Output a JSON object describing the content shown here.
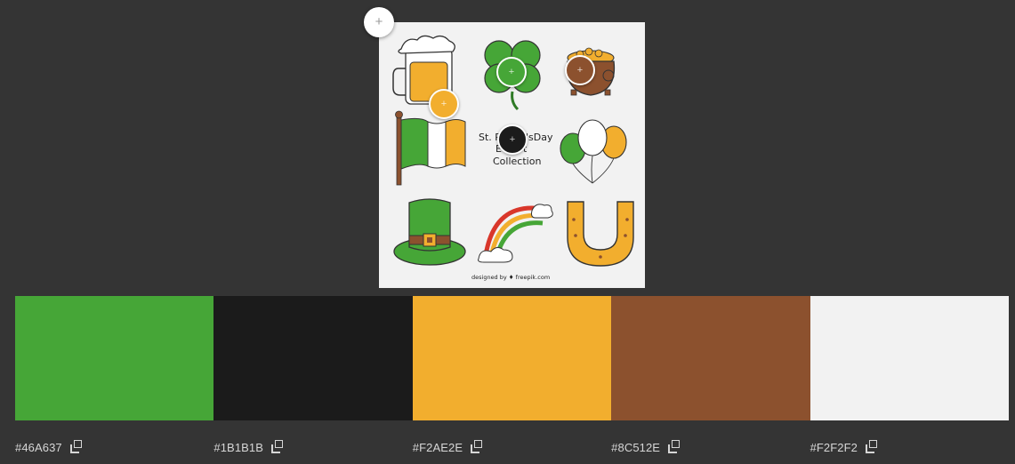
{
  "image": {
    "caption_lines": [
      "St. P",
      "'sDay",
      "E",
      "t",
      "Collection"
    ],
    "credit": "designed by ♦ freepik.com"
  },
  "add_button": {
    "icon": "plus-icon",
    "glyph": "+"
  },
  "pickers": [
    {
      "name": "picker-orange",
      "color": "#F2AE2E"
    },
    {
      "name": "picker-green",
      "color": "#46A637"
    },
    {
      "name": "picker-brown",
      "color": "#8C512E"
    },
    {
      "name": "picker-black",
      "color": "#1B1B1B"
    }
  ],
  "palette": [
    {
      "hex": "#46A637",
      "color": "#46A637"
    },
    {
      "hex": "#1B1B1B",
      "color": "#1B1B1B"
    },
    {
      "hex": "#F2AE2E",
      "color": "#F2AE2E"
    },
    {
      "hex": "#8C512E",
      "color": "#8C512E"
    },
    {
      "hex": "#F2F2F2",
      "color": "#F2F2F2"
    }
  ],
  "copy_icon": "copy-icon"
}
